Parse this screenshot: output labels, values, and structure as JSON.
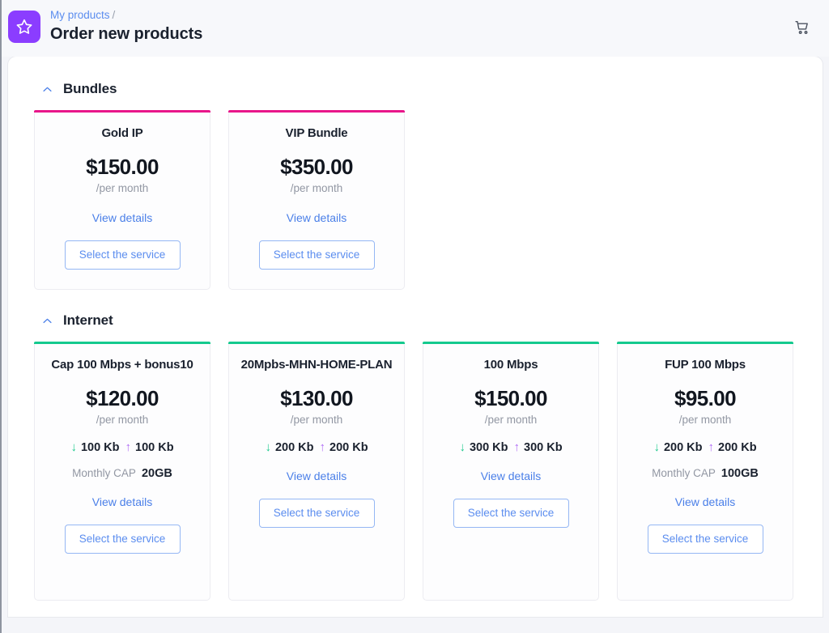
{
  "header": {
    "logo_icon": "star-icon",
    "breadcrumb": {
      "parent": "My products",
      "separator": "/"
    },
    "title": "Order new products",
    "cart_icon": "shopping-cart-icon"
  },
  "colors": {
    "brand_purple": "#8b3dff",
    "bundles_accent": "#e8168a",
    "internet_accent": "#14c98e",
    "link_blue": "#4a7fe8",
    "download_arrow": "#1fc98d",
    "upload_arrow": "#b06cf5"
  },
  "labels": {
    "view_details": "View details",
    "select_service": "Select the service",
    "per_month": "/per month",
    "monthly_cap": "Monthly CAP",
    "arrow_down": "↓",
    "arrow_up": "↑"
  },
  "sections": [
    {
      "id": "bundles",
      "title": "Bundles",
      "collapse_icon": "chevron-up-icon",
      "expanded": true,
      "accent": "#e8168a",
      "cards": [
        {
          "name": "Gold IP",
          "price": "$150.00",
          "period": "/per month",
          "speed_down": null,
          "speed_up": null,
          "cap": null,
          "view_details": "View details",
          "select_label": "Select the service"
        },
        {
          "name": "VIP Bundle",
          "price": "$350.00",
          "period": "/per month",
          "speed_down": null,
          "speed_up": null,
          "cap": null,
          "view_details": "View details",
          "select_label": "Select the service"
        }
      ]
    },
    {
      "id": "internet",
      "title": "Internet",
      "collapse_icon": "chevron-up-icon",
      "expanded": true,
      "accent": "#14c98e",
      "cards": [
        {
          "name": "Cap 100 Mbps + bonus10",
          "price": "$120.00",
          "period": "/per month",
          "speed_down": "100 Kb",
          "speed_up": "100 Kb",
          "cap": "20GB",
          "cap_label": "Monthly CAP",
          "view_details": "View details",
          "select_label": "Select the service"
        },
        {
          "name": "20Mpbs-MHN-HOME-PLAN",
          "price": "$130.00",
          "period": "/per month",
          "speed_down": "200 Kb",
          "speed_up": "200 Kb",
          "cap": null,
          "cap_label": null,
          "view_details": "View details",
          "select_label": "Select the service"
        },
        {
          "name": "100 Mbps",
          "price": "$150.00",
          "period": "/per month",
          "speed_down": "300 Kb",
          "speed_up": "300 Kb",
          "cap": null,
          "cap_label": null,
          "view_details": "View details",
          "select_label": "Select the service"
        },
        {
          "name": "FUP 100 Mbps",
          "price": "$95.00",
          "period": "/per month",
          "speed_down": "200 Kb",
          "speed_up": "200 Kb",
          "cap": "100GB",
          "cap_label": "Monthly CAP",
          "view_details": "View details",
          "select_label": "Select the service"
        }
      ]
    }
  ]
}
